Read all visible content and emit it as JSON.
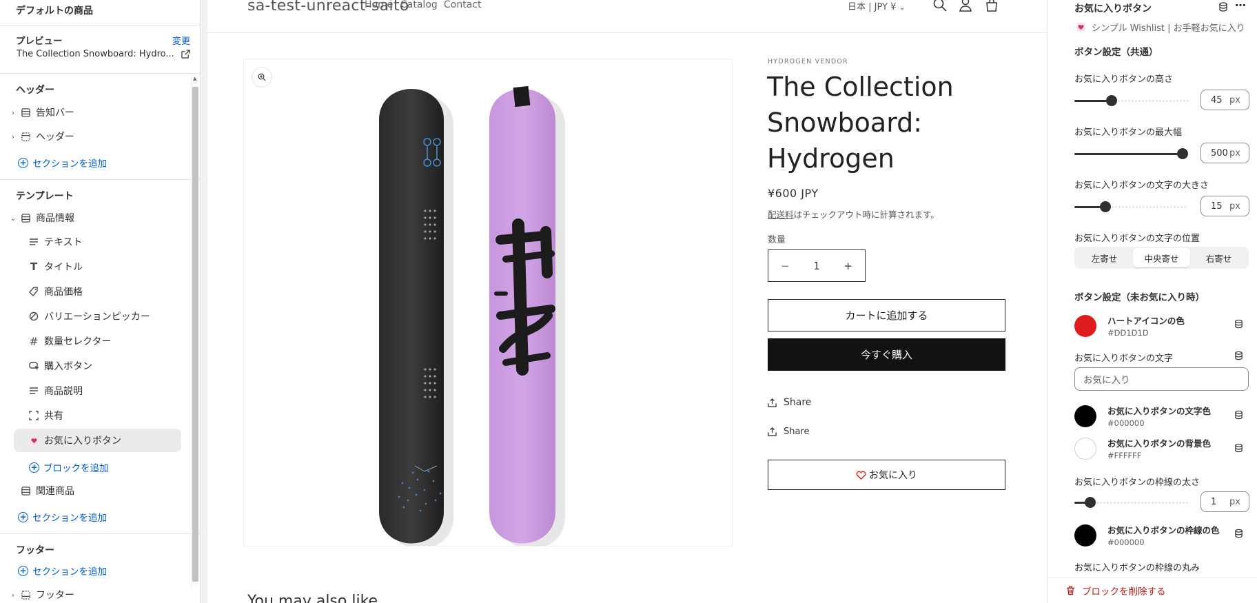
{
  "left": {
    "top_title": "デフォルトの商品",
    "preview_label": "プレビュー",
    "preview_change": "変更",
    "preview_product": "The Collection Snowboard: Hydro...",
    "header_heading": "ヘッダー",
    "header_items": [
      "告知バー",
      "ヘッダー"
    ],
    "add_section": "セクションを追加",
    "template_heading": "テンプレート",
    "product_info": "商品情報",
    "blocks": [
      "テキスト",
      "タイトル",
      "商品価格",
      "バリエーションピッカー",
      "数量セレクター",
      "購入ボタン",
      "商品説明",
      "共有",
      "お気に入りボタン"
    ],
    "add_block": "ブロックを追加",
    "related": "関連商品",
    "footer_heading": "フッター",
    "footer_item": "フッター"
  },
  "store": {
    "name": "sa-test-unreact-saito",
    "nav": [
      "Home",
      "Catalog",
      "Contact"
    ],
    "locale": "日本 | JPY ¥",
    "vendor": "HYDROGEN VENDOR",
    "title": "The Collection Snowboard: Hydrogen",
    "price": "¥600 JPY",
    "shipping_link": "配送料",
    "shipping_rest": "はチェックアウト時に計算されます。",
    "quantity_label": "数量",
    "quantity": "1",
    "minus": "−",
    "plus": "+",
    "add_to_cart": "カートに追加する",
    "buy_now": "今すぐ購入",
    "share1": "Share",
    "share2": "Share",
    "wishlist": "お気に入り",
    "you_may_also_like": "You may also like"
  },
  "right": {
    "title": "お気に入りボタン",
    "app_line": "シンプル Wishlist | お手軽お気に入り",
    "section_common": "ボタン設定（共通）",
    "height_label": "お気に入りボタンの高さ",
    "height_value": "45",
    "height_fraction": 0.31,
    "maxwidth_label": "お気に入りボタンの最大幅",
    "maxwidth_value": "500",
    "maxwidth_fraction": 1.0,
    "fontsize_label": "お気に入りボタンの文字の大きさ",
    "fontsize_value": "15",
    "fontsize_fraction": 0.25,
    "unit": "px",
    "align_label": "お気に入りボタンの文字の位置",
    "align_options": [
      "左寄せ",
      "中央寄せ",
      "右寄せ"
    ],
    "align_selected": "中央寄せ",
    "section_unfav": "ボタン設定（未お気に入り時）",
    "heart_color_label": "ハートアイコンの色",
    "heart_color": "#DD1D1D",
    "btn_text_label": "お気に入りボタンの文字",
    "btn_text_value": "お気に入り",
    "text_color_label": "お気に入りボタンの文字色",
    "text_color": "#000000",
    "bg_color_label": "お気に入りボタンの背景色",
    "bg_color": "#FFFFFF",
    "border_width_label": "お気に入りボタンの枠線の太さ",
    "border_width_value": "1",
    "border_width_fraction": 0.1,
    "border_color_label": "お気に入りボタンの枠線の色",
    "border_color": "#000000",
    "border_radius_label": "お気に入りボタンの枠線の丸み",
    "delete_block": "ブロックを削除する"
  },
  "colors": {
    "accent_link": "#005bd3",
    "heart": "#DD1D1D",
    "danger": "#b31b1b"
  }
}
